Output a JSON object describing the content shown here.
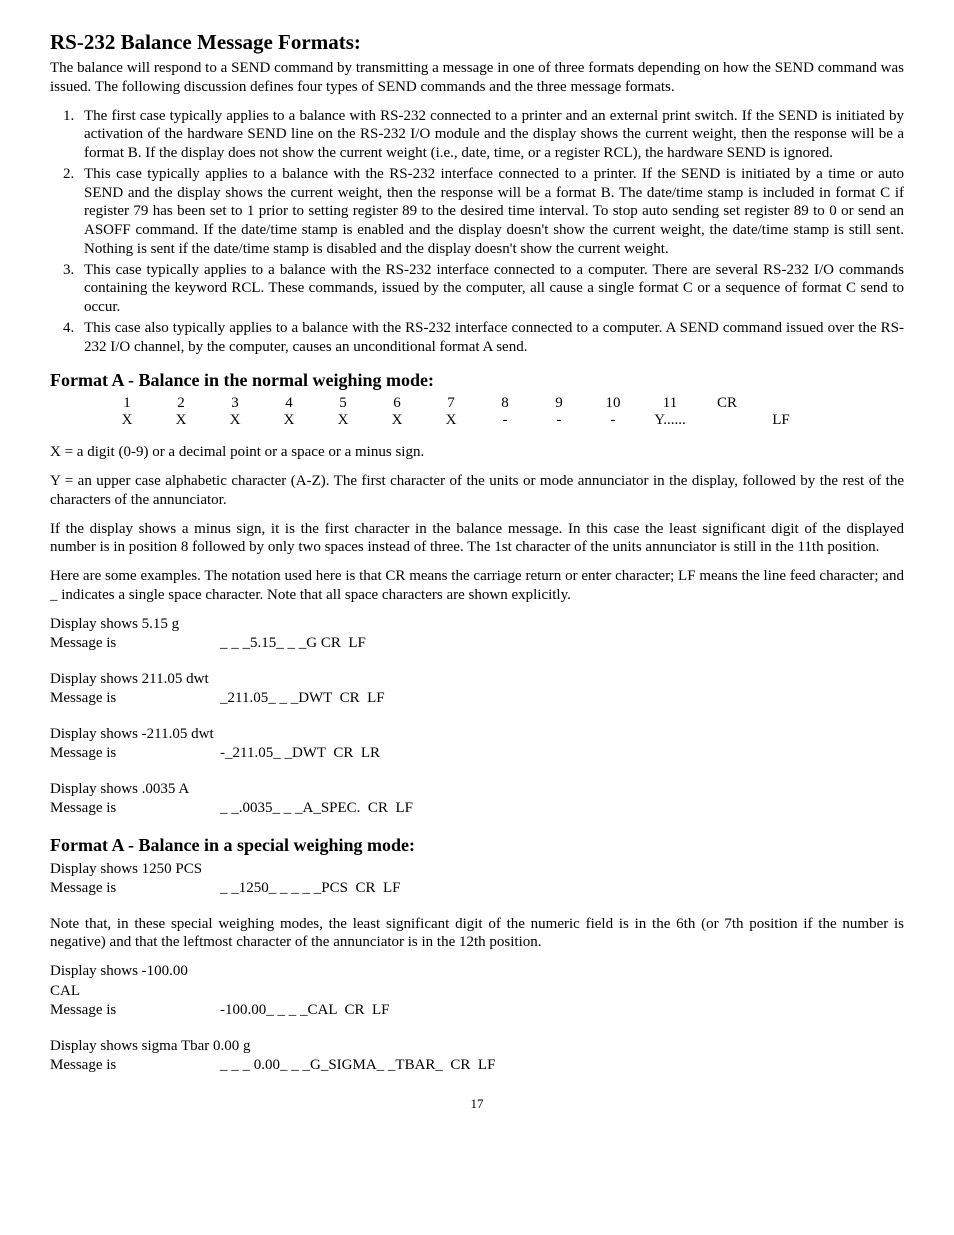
{
  "title": "RS-232 Balance Message Formats:",
  "intro": "The balance will respond to a SEND command by transmitting a message in one of three formats depending on how the SEND command was issued.  The following discussion defines four types of SEND commands and the three message formats.",
  "cases": [
    "The first case typically applies to a balance with RS-232 connected to a printer and an external print switch.  If the SEND is initiated by activation of the hardware SEND line on the RS-232 I/O module and the display shows the current weight, then the response will be a format B.  If the display does not show the current weight (i.e., date, time, or a register RCL), the hardware SEND is ignored.",
    "This case typically applies to a balance with the RS-232 interface connected to a printer.  If the SEND is initiated by a time or auto SEND and the display shows the current weight, then the response will be a format B.  The date/time stamp is included in format C if register 79 has been set to 1 prior to setting register 89 to the desired time interval.  To stop auto sending set register 89 to 0 or send an ASOFF command.  If the date/time stamp is enabled and the display doesn't show the current weight, the date/time stamp is still sent.  Nothing is sent if the date/time stamp is disabled and the display doesn't show the current weight.",
    "This case typically applies to a balance with the RS-232 interface connected to a computer.  There are several RS-232 I/O commands containing the keyword RCL.  These commands, issued by the computer, all cause a single format C or a sequence of format C send to occur.",
    "This case also typically applies to a balance with the RS-232 interface connected to a computer.  A SEND command issued over the RS-232 I/O channel, by the computer, causes an unconditional format A send."
  ],
  "formatA_normal_heading": "Format A - Balance in the normal weighing mode:",
  "fmt_table": {
    "row1": [
      "1",
      "2",
      "3",
      "4",
      "5",
      "6",
      "7",
      "8",
      "9",
      "10",
      "11",
      "CR",
      ""
    ],
    "row2": [
      "X",
      "X",
      "X",
      "X",
      "X",
      "X",
      "X",
      "-",
      "-",
      "-",
      "Y......",
      "",
      "LF"
    ]
  },
  "legend_x": "X = a digit (0-9) or a decimal point or a space or a minus sign.",
  "legend_y": "Y = an upper case alphabetic character (A-Z).  The first character of the units or mode annunciator in the display, followed by the rest of the characters of the annunciator.",
  "minus_note": "If the display shows a minus sign, it is the first character in the balance message.  In this case the least significant digit of the displayed number is in position 8 followed by only two spaces instead of three.  The 1st character of the units annunciator is still in the 11th position.",
  "examples_intro": "Here are some examples.  The notation used here is that CR means the carriage return or enter character;  LF means the line feed character; and  _  indicates a single space character.  Note that all space characters are shown explicitly.",
  "examples_normal": [
    {
      "display": "Display shows 5.15 g",
      "msg_label": "Message is",
      "msg": "_ _ _5.15_ _ _G CR  LF"
    },
    {
      "display": "Display shows 211.05 dwt",
      "msg_label": "Message is",
      "msg": "_211.05_ _ _DWT  CR  LF"
    },
    {
      "display": "Display shows -211.05 dwt",
      "msg_label": "Message is",
      "msg": "-_211.05_ _DWT  CR  LR"
    },
    {
      "display": "Display shows .0035 A",
      "msg_label": "Message is",
      "msg": "_ _.0035_ _ _A_SPEC.  CR  LF"
    }
  ],
  "formatA_special_heading": "Format A - Balance in a special weighing mode:",
  "examples_special_1": [
    {
      "display": "Display shows 1250 PCS",
      "msg_label": "Message is",
      "msg": "_ _1250_ _ _ _ _PCS  CR  LF"
    }
  ],
  "special_note": "Note that, in these special weighing modes, the least significant digit of the numeric field is in the 6th (or 7th position if the number is negative) and that the leftmost character of the annunciator is in the 12th position.",
  "examples_special_2": [
    {
      "display": "Display shows -100.00 CAL",
      "msg_label": "Message is",
      "msg": "-100.00_ _ _ _CAL  CR  LF"
    },
    {
      "display": "Display shows sigma Tbar 0.00 g",
      "msg_label": "Message is",
      "msg": "_ _ _ 0.00_ _ _G_SIGMA_ _TBAR_  CR  LF"
    }
  ],
  "page_number": "17"
}
